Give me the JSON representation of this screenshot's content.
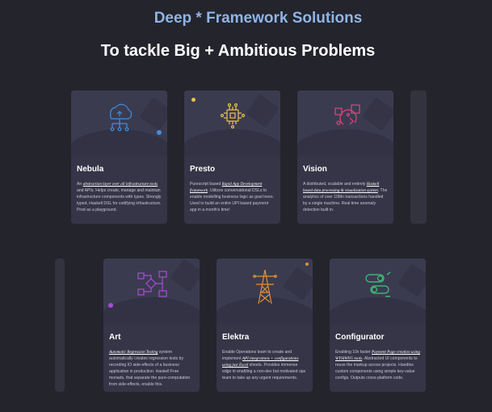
{
  "header": {
    "kicker": "Deep * Framework Solutions",
    "headline": "To tackle Big + Ambitious Problems"
  },
  "cards": [
    {
      "title": "Nebula",
      "icon": "cloud-network-icon",
      "desc": {
        "a": "An ",
        "link": "abstraction layer over all infrastructure tools",
        "b": " and APIs. Helps create, manage and maintain infrastructure components with types. Strongly typed, Haskell DSL for codifying infrastructure. Prod as a playground."
      }
    },
    {
      "title": "Presto",
      "icon": "cpu-chip-icon",
      "desc": {
        "a": "Purescript based ",
        "link": "Rapid App Development framework",
        "b": ". Utilizes conversational DSLs to enable modelling business logic as goal trees. Used to build an entire UPI based payment app in a month's time!"
      }
    },
    {
      "title": "Vision",
      "icon": "data-processing-icon",
      "desc": {
        "a": "A distributed, scalable and entirely ",
        "link": "Haskell based data processing & visualization system",
        "b": ". The analytics of over 10Mn transactions handled by a single machine. Real time anomaly detection built in."
      }
    },
    {
      "title": "Art",
      "icon": "flow-diagram-icon",
      "desc": {
        "a": "",
        "link": "Automatic Regression Testing",
        "b": " system automatically creates regression tests by recording IO side-effects of a business application in production. Haskell Free monads, that separate the pure-computation from side-effects, enable this."
      }
    },
    {
      "title": "Elektra",
      "icon": "transmission-tower-icon",
      "desc": {
        "a": "Enable Operations team to create and implement ",
        "link": "API integrations + configurations using just Excel",
        "b": " sheets. Provides immense edge in enabling a non-dev but motivated ops team to take up any urgent requirements."
      }
    },
    {
      "title": "Configurator",
      "icon": "toggle-switch-icon",
      "desc": {
        "a": "Enabling 10x faster ",
        "link": "Payment Page creation using WYSIWYG tools",
        "b": ". Abstracted UI components to reuse the markup across projects. Handles custom components using simple key-value configs. Outputs cross-platform code."
      }
    }
  ],
  "colors": {
    "kicker": "#8fb4e6",
    "nebula": "#3f8fe0",
    "presto": "#e8c24a",
    "vision": "#e0457b",
    "art": "#a94ad8",
    "elektra": "#e2903a",
    "configurator": "#3fc97c"
  }
}
